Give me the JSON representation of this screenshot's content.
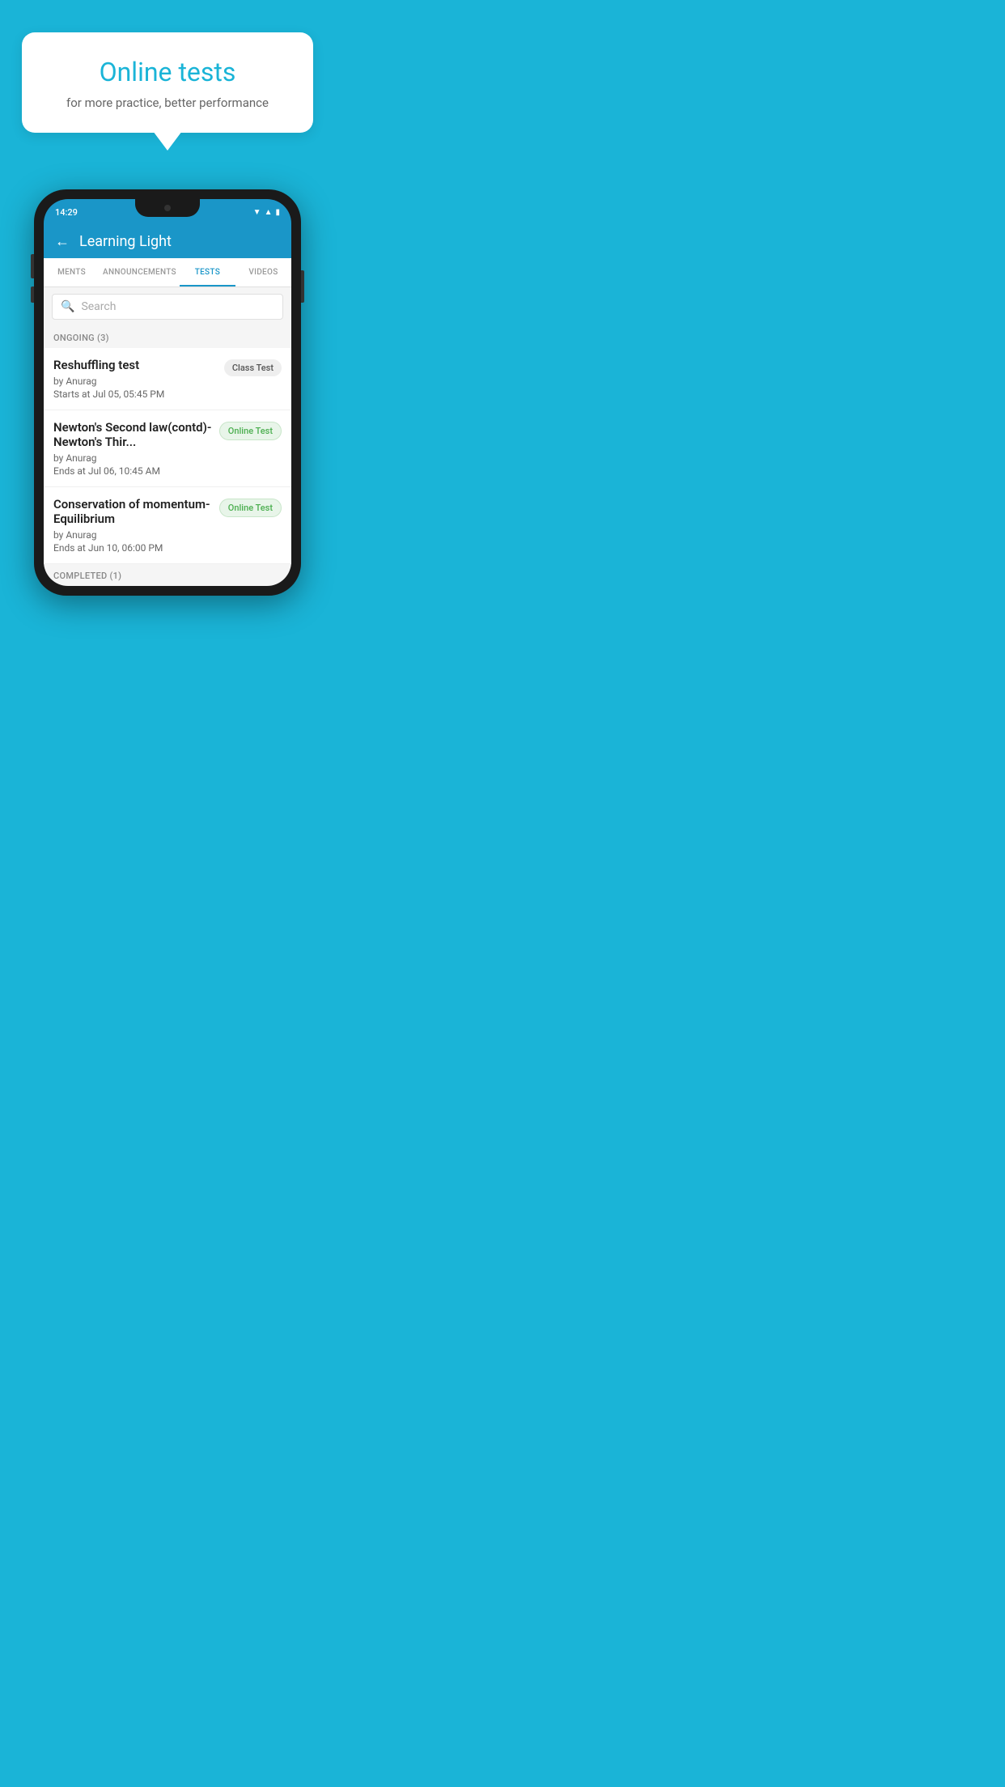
{
  "background_color": "#1ab4d7",
  "bubble": {
    "title": "Online tests",
    "subtitle": "for more practice, better performance"
  },
  "phone": {
    "status_bar": {
      "time": "14:29",
      "icons": [
        "wifi",
        "signal",
        "battery"
      ]
    },
    "app_header": {
      "back_label": "←",
      "title": "Learning Light"
    },
    "tabs": [
      {
        "label": "MENTS",
        "active": false
      },
      {
        "label": "ANNOUNCEMENTS",
        "active": false
      },
      {
        "label": "TESTS",
        "active": true
      },
      {
        "label": "VIDEOS",
        "active": false
      }
    ],
    "search": {
      "placeholder": "Search"
    },
    "section_ongoing": {
      "header": "ONGOING (3)"
    },
    "tests": [
      {
        "name": "Reshuffling test",
        "author": "by Anurag",
        "date_label": "Starts at",
        "date": "Jul 05, 05:45 PM",
        "badge": "Class Test",
        "badge_type": "class"
      },
      {
        "name": "Newton's Second law(contd)-Newton's Thir...",
        "author": "by Anurag",
        "date_label": "Ends at",
        "date": "Jul 06, 10:45 AM",
        "badge": "Online Test",
        "badge_type": "online"
      },
      {
        "name": "Conservation of momentum-Equilibrium",
        "author": "by Anurag",
        "date_label": "Ends at",
        "date": "Jun 10, 06:00 PM",
        "badge": "Online Test",
        "badge_type": "online"
      }
    ],
    "section_completed": {
      "header": "COMPLETED (1)"
    }
  }
}
